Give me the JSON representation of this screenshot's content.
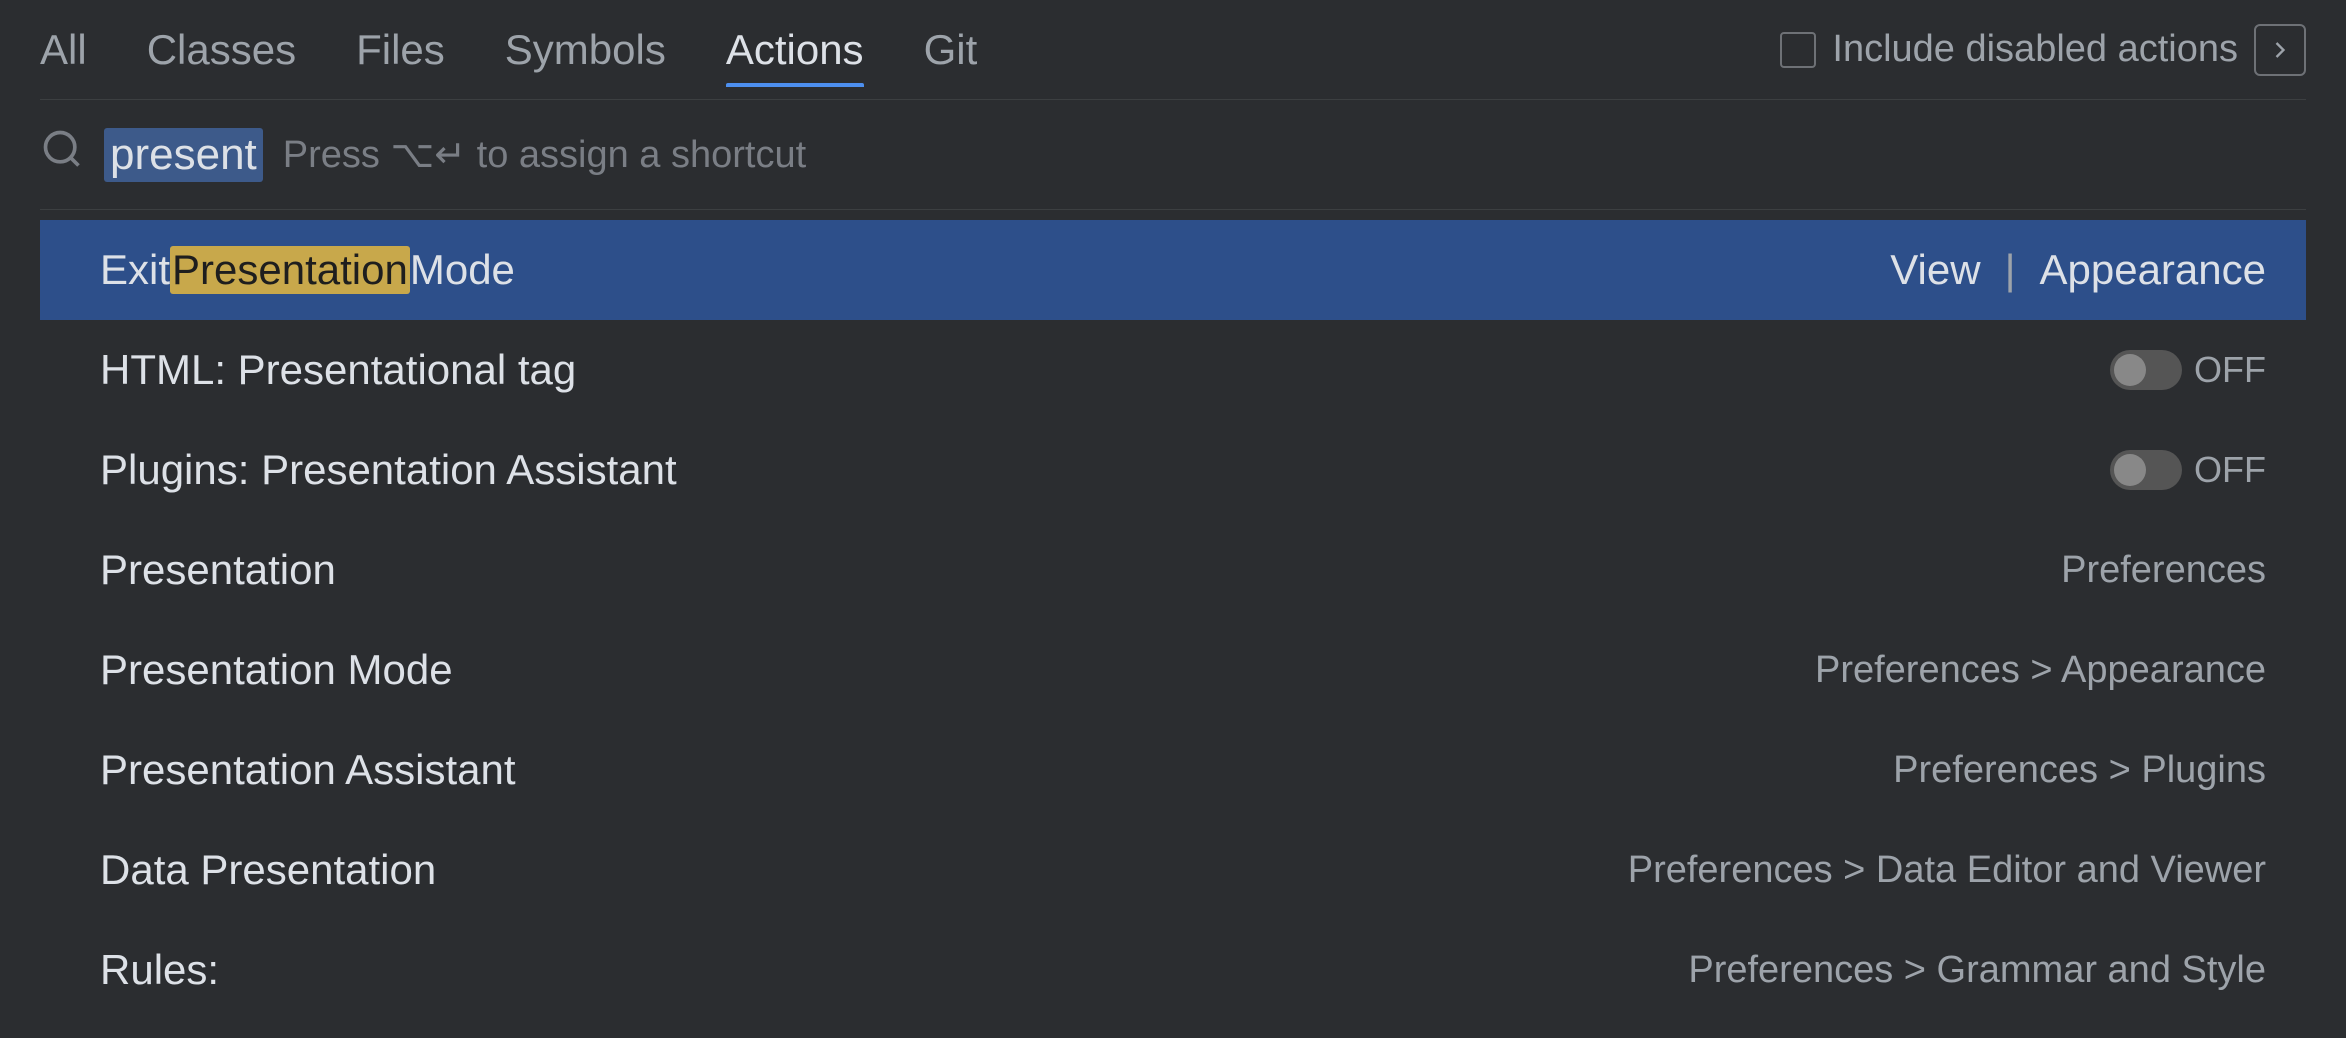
{
  "tabs": {
    "items": [
      {
        "id": "all",
        "label": "All",
        "active": false
      },
      {
        "id": "classes",
        "label": "Classes",
        "active": false
      },
      {
        "id": "files",
        "label": "Files",
        "active": false
      },
      {
        "id": "symbols",
        "label": "Symbols",
        "active": false
      },
      {
        "id": "actions",
        "label": "Actions",
        "active": true
      },
      {
        "id": "git",
        "label": "Git",
        "active": false
      }
    ]
  },
  "include_disabled": {
    "label": "Include disabled actions"
  },
  "search": {
    "query_prefix": "present",
    "placeholder": "present",
    "shortcut_hint": "Press ⌥↵ to assign a shortcut"
  },
  "results": [
    {
      "id": "exit-presentation-mode",
      "label_before_highlight": "Exit ",
      "highlight": "Presentation",
      "label_after_highlight": " Mode",
      "meta": "View | Appearance",
      "selected": true,
      "type": "action"
    },
    {
      "id": "html-presentational-tag",
      "label_before_highlight": "HTML: Presentational tag",
      "highlight": "",
      "label_after_highlight": "",
      "toggle": "OFF",
      "selected": false,
      "type": "toggle"
    },
    {
      "id": "plugins-presentation-assistant",
      "label_before_highlight": "Plugins: Presentation Assistant",
      "highlight": "",
      "label_after_highlight": "",
      "toggle": "OFF",
      "selected": false,
      "type": "toggle"
    },
    {
      "id": "presentation",
      "label_before_highlight": "Presentation",
      "highlight": "",
      "label_after_highlight": "",
      "meta": "Preferences",
      "selected": false,
      "type": "action"
    },
    {
      "id": "presentation-mode",
      "label_before_highlight": "Presentation Mode",
      "highlight": "",
      "label_after_highlight": "",
      "meta": "Preferences > Appearance",
      "selected": false,
      "type": "action"
    },
    {
      "id": "presentation-assistant",
      "label_before_highlight": "Presentation Assistant",
      "highlight": "",
      "label_after_highlight": "",
      "meta": "Preferences > Plugins",
      "selected": false,
      "type": "action"
    },
    {
      "id": "data-presentation",
      "label_before_highlight": "Data Presentation",
      "highlight": "",
      "label_after_highlight": "",
      "meta": "Preferences > Data Editor and Viewer",
      "selected": false,
      "type": "action"
    },
    {
      "id": "rules",
      "label_before_highlight": "Rules:",
      "highlight": "",
      "label_after_highlight": "",
      "meta": "Preferences > Grammar and Style",
      "selected": false,
      "type": "action"
    }
  ]
}
